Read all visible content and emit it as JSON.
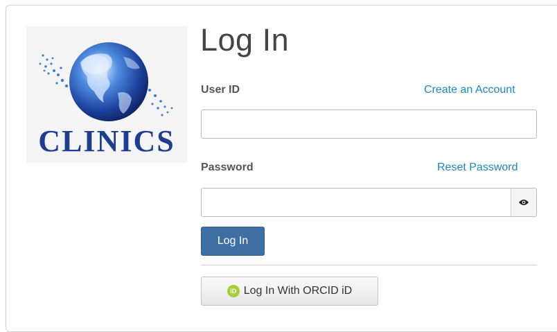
{
  "logo": {
    "text": "CLINICS",
    "icon": "globe-logo-icon"
  },
  "login": {
    "title": "Log In",
    "user_id_label": "User ID",
    "create_account_link": "Create an Account",
    "user_id_value": "",
    "password_label": "Password",
    "reset_password_link": "Reset Password",
    "password_value": "",
    "show_password_icon": "eye-icon",
    "login_button": "Log In",
    "orcid_icon_text": "iD",
    "orcid_button": "Log In With ORCID iD"
  },
  "colors": {
    "link": "#1a88c2",
    "primary_button": "#3f6fa2",
    "orcid_green": "#a6ce39",
    "logo_blue": "#1e3d8f"
  }
}
